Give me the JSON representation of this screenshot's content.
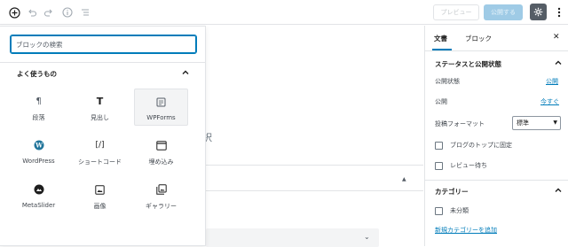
{
  "toolbar": {
    "preview_label": "プレビュー",
    "publish_label": "公開する",
    "icons": [
      "add-block-icon",
      "undo-icon",
      "redo-icon",
      "info-icon",
      "list-view-icon",
      "gear-icon",
      "more-vertical-icon"
    ]
  },
  "inserter": {
    "search_placeholder": "ブロックの検索",
    "section_title": "よく使うもの",
    "blocks": [
      {
        "label": "段落",
        "icon": "paragraph-icon"
      },
      {
        "label": "見出し",
        "icon": "heading-icon"
      },
      {
        "label": "WPForms",
        "icon": "wpforms-icon",
        "active": true
      },
      {
        "label": "WordPress",
        "icon": "wordpress-icon"
      },
      {
        "label": "ショートコード",
        "icon": "shortcode-icon"
      },
      {
        "label": "埋め込み",
        "icon": "embed-icon"
      },
      {
        "label": "MetaSlider",
        "icon": "metaslider-icon"
      },
      {
        "label": "画像",
        "icon": "image-icon"
      },
      {
        "label": "ギャラリー",
        "icon": "gallery-icon"
      }
    ]
  },
  "editor": {
    "partial_char": "択"
  },
  "sidebar": {
    "tabs": [
      "文書",
      "ブロック"
    ],
    "status_panel": {
      "title": "ステータスと公開状態",
      "visibility_label": "公開状態",
      "visibility_value": "公開",
      "publish_label": "公開",
      "publish_value": "今すぐ",
      "format_label": "投稿フォーマット",
      "format_value": "標準",
      "sticky_label": "ブログのトップに固定",
      "pending_label": "レビュー待ち"
    },
    "category_panel": {
      "title": "カテゴリー",
      "uncategorized_label": "未分類",
      "add_new_link": "新規カテゴリーを追加"
    }
  },
  "colors": {
    "accent": "#007cba",
    "publish_disabled": "#9fcbe6",
    "gear_bg": "#555d66"
  }
}
